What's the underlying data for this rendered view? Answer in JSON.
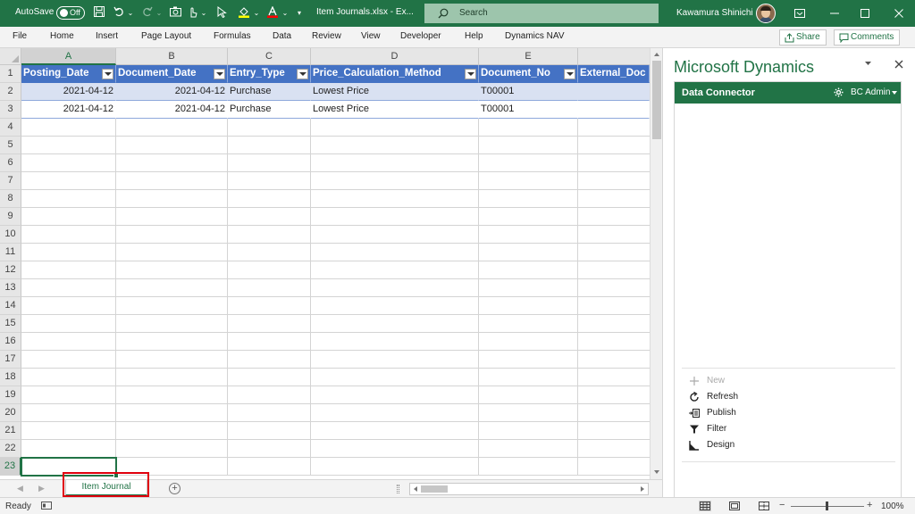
{
  "titlebar": {
    "autosave_label": "AutoSave",
    "autosave_state": "Off",
    "filename": "Item Journals.xlsx  -  Ex...",
    "search_placeholder": "Search",
    "user_name": "Kawamura Shinichi",
    "accent_color": "#217346"
  },
  "ribbon": {
    "tabs": [
      "File",
      "Home",
      "Insert",
      "Page Layout",
      "Formulas",
      "Data",
      "Review",
      "View",
      "Developer",
      "Help",
      "Dynamics NAV"
    ],
    "share_label": "Share",
    "comments_label": "Comments"
  },
  "grid": {
    "columns": [
      "A",
      "B",
      "C",
      "D",
      "E",
      ""
    ],
    "rows": [
      "1",
      "2",
      "3",
      "4",
      "5",
      "6",
      "7",
      "8",
      "9",
      "10",
      "11",
      "12",
      "13",
      "14",
      "15",
      "16",
      "17",
      "18",
      "19",
      "20",
      "21",
      "22",
      "23"
    ],
    "headers": [
      "Posting_Date",
      "Document_Date",
      "Entry_Type",
      "Price_Calculation_Method",
      "Document_No",
      "External_Doc"
    ],
    "data": [
      [
        "2021-04-12",
        "2021-04-12",
        "Purchase",
        "Lowest Price",
        "T00001",
        ""
      ],
      [
        "2021-04-12",
        "2021-04-12",
        "Purchase",
        "Lowest Price",
        "T00001",
        ""
      ]
    ],
    "table_header_color": "#4472c4",
    "band_color": "#d9e1f2",
    "active_cell": "A23"
  },
  "sheets": {
    "tabs": [
      "Item Journal"
    ],
    "active": "Item Journal"
  },
  "pane": {
    "title": "Microsoft Dynamics",
    "connector_title": "Data Connector",
    "user": "BC Admin",
    "actions": [
      {
        "label": "New",
        "icon": "plus-icon",
        "enabled": false
      },
      {
        "label": "Refresh",
        "icon": "refresh-icon",
        "enabled": true
      },
      {
        "label": "Publish",
        "icon": "publish-icon",
        "enabled": true
      },
      {
        "label": "Filter",
        "icon": "filter-icon",
        "enabled": true
      },
      {
        "label": "Design",
        "icon": "design-icon",
        "enabled": true
      }
    ]
  },
  "status": {
    "ready": "Ready",
    "zoom": "100%"
  }
}
